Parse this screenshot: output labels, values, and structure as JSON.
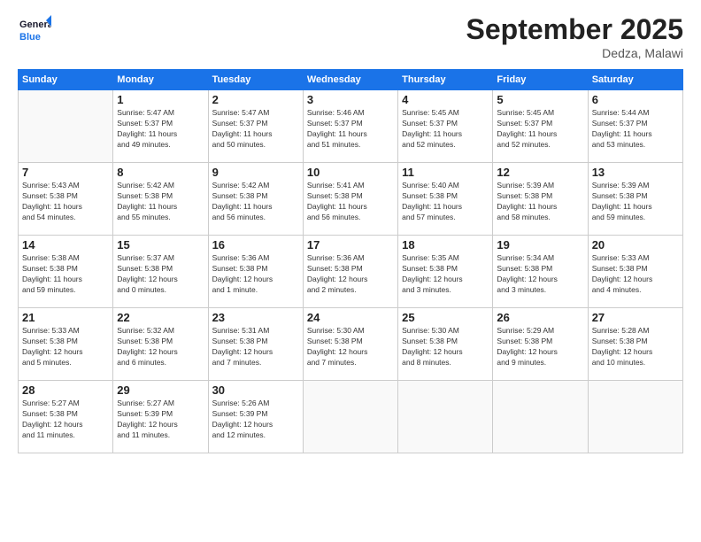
{
  "logo": {
    "line1": "General",
    "line2": "Blue"
  },
  "header": {
    "month": "September 2025",
    "location": "Dedza, Malawi"
  },
  "days_of_week": [
    "Sunday",
    "Monday",
    "Tuesday",
    "Wednesday",
    "Thursday",
    "Friday",
    "Saturday"
  ],
  "weeks": [
    [
      {
        "day": "",
        "content": ""
      },
      {
        "day": "1",
        "content": "Sunrise: 5:47 AM\nSunset: 5:37 PM\nDaylight: 11 hours\nand 49 minutes."
      },
      {
        "day": "2",
        "content": "Sunrise: 5:47 AM\nSunset: 5:37 PM\nDaylight: 11 hours\nand 50 minutes."
      },
      {
        "day": "3",
        "content": "Sunrise: 5:46 AM\nSunset: 5:37 PM\nDaylight: 11 hours\nand 51 minutes."
      },
      {
        "day": "4",
        "content": "Sunrise: 5:45 AM\nSunset: 5:37 PM\nDaylight: 11 hours\nand 52 minutes."
      },
      {
        "day": "5",
        "content": "Sunrise: 5:45 AM\nSunset: 5:37 PM\nDaylight: 11 hours\nand 52 minutes."
      },
      {
        "day": "6",
        "content": "Sunrise: 5:44 AM\nSunset: 5:37 PM\nDaylight: 11 hours\nand 53 minutes."
      }
    ],
    [
      {
        "day": "7",
        "content": "Sunrise: 5:43 AM\nSunset: 5:38 PM\nDaylight: 11 hours\nand 54 minutes."
      },
      {
        "day": "8",
        "content": "Sunrise: 5:42 AM\nSunset: 5:38 PM\nDaylight: 11 hours\nand 55 minutes."
      },
      {
        "day": "9",
        "content": "Sunrise: 5:42 AM\nSunset: 5:38 PM\nDaylight: 11 hours\nand 56 minutes."
      },
      {
        "day": "10",
        "content": "Sunrise: 5:41 AM\nSunset: 5:38 PM\nDaylight: 11 hours\nand 56 minutes."
      },
      {
        "day": "11",
        "content": "Sunrise: 5:40 AM\nSunset: 5:38 PM\nDaylight: 11 hours\nand 57 minutes."
      },
      {
        "day": "12",
        "content": "Sunrise: 5:39 AM\nSunset: 5:38 PM\nDaylight: 11 hours\nand 58 minutes."
      },
      {
        "day": "13",
        "content": "Sunrise: 5:39 AM\nSunset: 5:38 PM\nDaylight: 11 hours\nand 59 minutes."
      }
    ],
    [
      {
        "day": "14",
        "content": "Sunrise: 5:38 AM\nSunset: 5:38 PM\nDaylight: 11 hours\nand 59 minutes."
      },
      {
        "day": "15",
        "content": "Sunrise: 5:37 AM\nSunset: 5:38 PM\nDaylight: 12 hours\nand 0 minutes."
      },
      {
        "day": "16",
        "content": "Sunrise: 5:36 AM\nSunset: 5:38 PM\nDaylight: 12 hours\nand 1 minute."
      },
      {
        "day": "17",
        "content": "Sunrise: 5:36 AM\nSunset: 5:38 PM\nDaylight: 12 hours\nand 2 minutes."
      },
      {
        "day": "18",
        "content": "Sunrise: 5:35 AM\nSunset: 5:38 PM\nDaylight: 12 hours\nand 3 minutes."
      },
      {
        "day": "19",
        "content": "Sunrise: 5:34 AM\nSunset: 5:38 PM\nDaylight: 12 hours\nand 3 minutes."
      },
      {
        "day": "20",
        "content": "Sunrise: 5:33 AM\nSunset: 5:38 PM\nDaylight: 12 hours\nand 4 minutes."
      }
    ],
    [
      {
        "day": "21",
        "content": "Sunrise: 5:33 AM\nSunset: 5:38 PM\nDaylight: 12 hours\nand 5 minutes."
      },
      {
        "day": "22",
        "content": "Sunrise: 5:32 AM\nSunset: 5:38 PM\nDaylight: 12 hours\nand 6 minutes."
      },
      {
        "day": "23",
        "content": "Sunrise: 5:31 AM\nSunset: 5:38 PM\nDaylight: 12 hours\nand 7 minutes."
      },
      {
        "day": "24",
        "content": "Sunrise: 5:30 AM\nSunset: 5:38 PM\nDaylight: 12 hours\nand 7 minutes."
      },
      {
        "day": "25",
        "content": "Sunrise: 5:30 AM\nSunset: 5:38 PM\nDaylight: 12 hours\nand 8 minutes."
      },
      {
        "day": "26",
        "content": "Sunrise: 5:29 AM\nSunset: 5:38 PM\nDaylight: 12 hours\nand 9 minutes."
      },
      {
        "day": "27",
        "content": "Sunrise: 5:28 AM\nSunset: 5:38 PM\nDaylight: 12 hours\nand 10 minutes."
      }
    ],
    [
      {
        "day": "28",
        "content": "Sunrise: 5:27 AM\nSunset: 5:38 PM\nDaylight: 12 hours\nand 11 minutes."
      },
      {
        "day": "29",
        "content": "Sunrise: 5:27 AM\nSunset: 5:39 PM\nDaylight: 12 hours\nand 11 minutes."
      },
      {
        "day": "30",
        "content": "Sunrise: 5:26 AM\nSunset: 5:39 PM\nDaylight: 12 hours\nand 12 minutes."
      },
      {
        "day": "",
        "content": ""
      },
      {
        "day": "",
        "content": ""
      },
      {
        "day": "",
        "content": ""
      },
      {
        "day": "",
        "content": ""
      }
    ]
  ]
}
